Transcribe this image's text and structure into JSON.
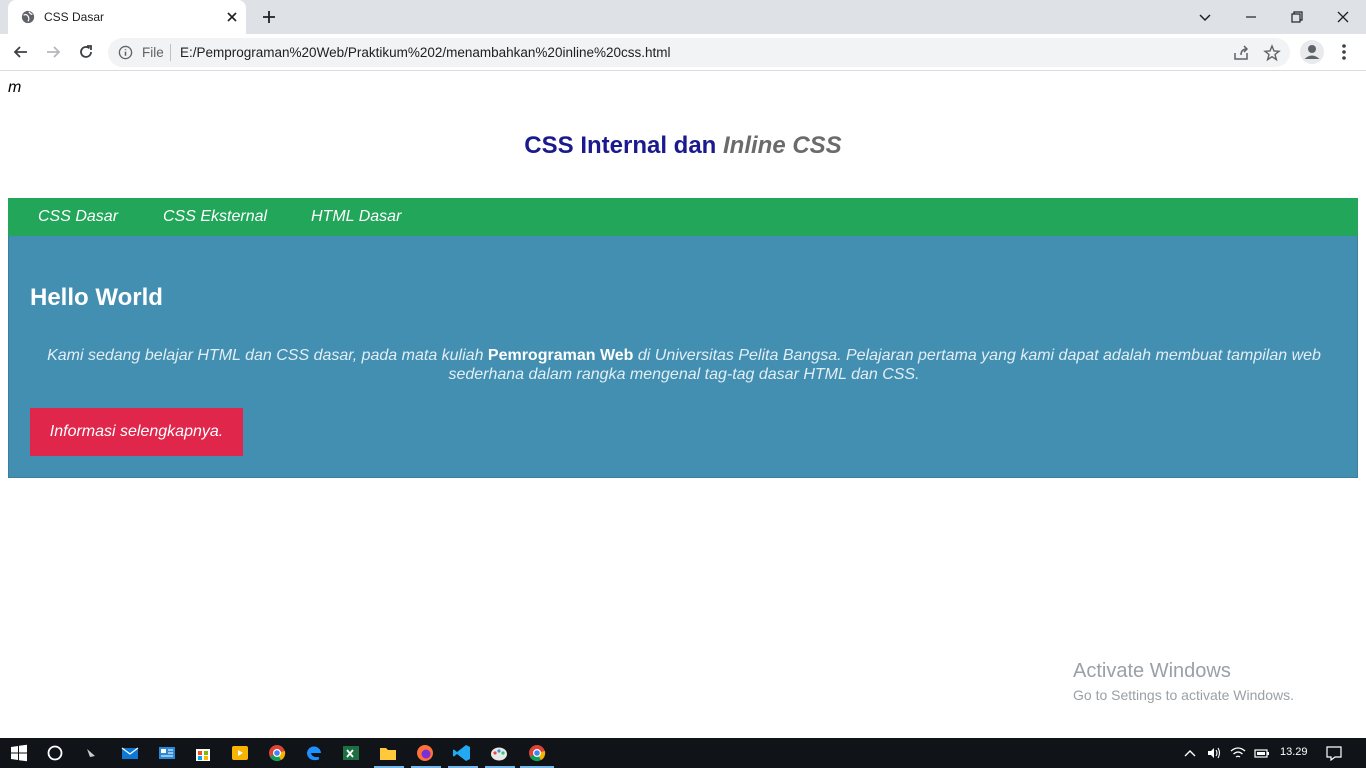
{
  "browser": {
    "tab_title": "CSS Dasar",
    "scheme_label": "File",
    "url": "E:/Pemprograman%20Web/Praktikum%202/menambahkan%20inline%20css.html"
  },
  "page": {
    "stray_text": "m",
    "title_main": "CSS Internal dan ",
    "title_em": "Inline CSS",
    "nav_items": [
      "CSS Dasar",
      "CSS Eksternal",
      "HTML Dasar"
    ],
    "heading": "Hello World",
    "para_before": "Kami sedang belajar HTML dan CSS dasar, pada mata kuliah ",
    "para_bold": "Pemrograman Web",
    "para_after": " di Universitas Pelita Bangsa. Pelajaran pertama yang kami dapat adalah membuat tampilan web sederhana dalam rangka mengenal tag-tag dasar HTML dan CSS.",
    "button_label": "Informasi selengkapnya."
  },
  "watermark": {
    "title": "Activate Windows",
    "subtitle": "Go to Settings to activate Windows."
  },
  "taskbar": {
    "clock": "13.29",
    "apps": [
      "start-icon",
      "search-icon",
      "taskview-icon",
      "mail-icon",
      "news-icon",
      "store-icon",
      "media-icon",
      "chrome-icon",
      "edge-icon",
      "excel-icon",
      "file-explorer-icon",
      "firefox-icon",
      "vscode-icon",
      "paint-icon",
      "chrome-active-icon"
    ]
  },
  "colors": {
    "nav_bg": "#22a65a",
    "content_bg": "#428fb2",
    "button_bg": "#e0264a",
    "title_color": "#1a1a8e"
  }
}
